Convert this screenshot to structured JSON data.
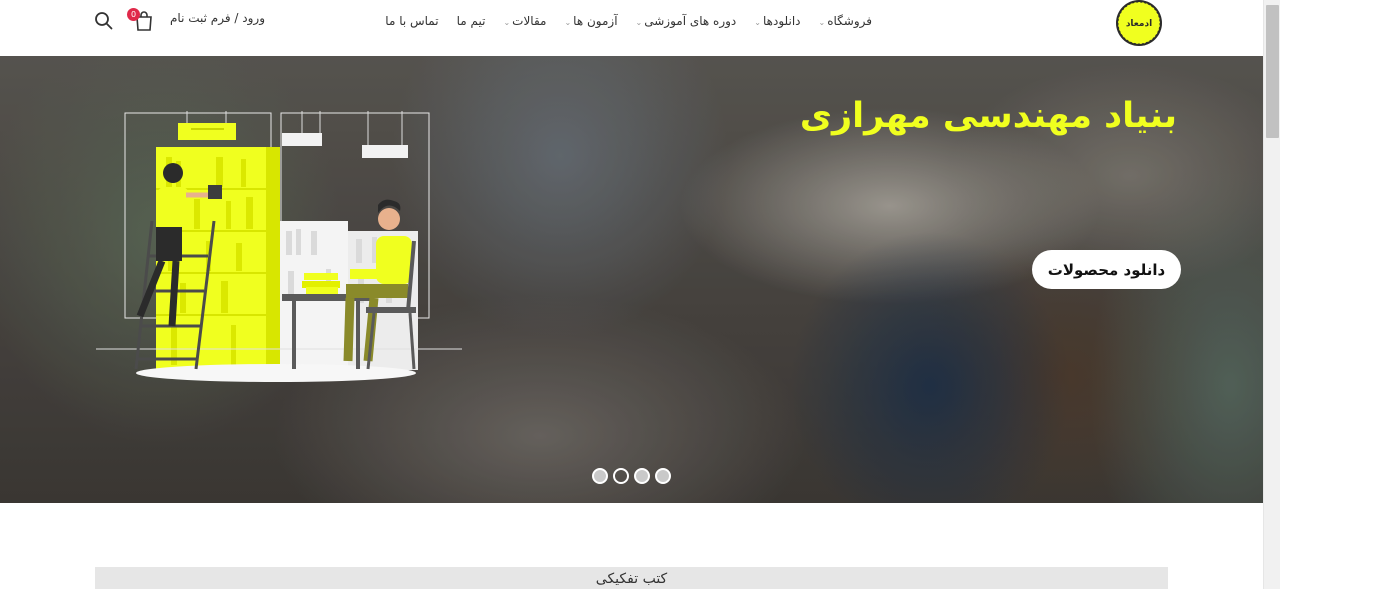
{
  "header": {
    "nav": [
      {
        "label": "فروشگاه",
        "has_dropdown": true
      },
      {
        "label": "دانلودها",
        "has_dropdown": true
      },
      {
        "label": "دوره های آموزشی",
        "has_dropdown": true
      },
      {
        "label": "آزمون ها",
        "has_dropdown": true
      },
      {
        "label": "مقالات",
        "has_dropdown": true
      },
      {
        "label": "تیم ما",
        "has_dropdown": false
      },
      {
        "label": "تماس با ما",
        "has_dropdown": false
      }
    ],
    "login_label": "ورود / فرم ثبت نام",
    "cart_count": "0",
    "logo_text": "دمعادل",
    "logo_color": "#f0ff1f"
  },
  "hero": {
    "title": "بنیاد مهندسی مهرازی",
    "cta_label": "دانلود محصولات",
    "title_color": "#f0ff1f",
    "slides": 4,
    "active_slide": 2
  },
  "section": {
    "title": "کتب تفکیکی"
  },
  "icons": {
    "search": "search-icon",
    "cart": "shopping-bag-icon",
    "dropdown": "chevron-down-icon"
  }
}
